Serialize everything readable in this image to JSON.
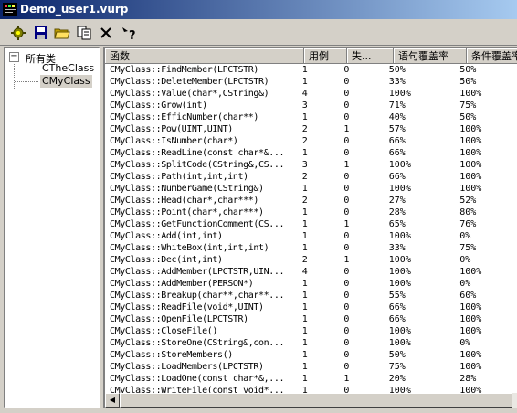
{
  "window": {
    "title": "Demo_user1.vurp"
  },
  "toolbar": {
    "buttons": [
      {
        "name": "settings-button",
        "icon": "gear-icon"
      },
      {
        "name": "save-button",
        "icon": "floppy-icon"
      },
      {
        "name": "open-button",
        "icon": "folder-open-icon"
      },
      {
        "name": "copy-button",
        "icon": "copy-icon"
      },
      {
        "name": "delete-button",
        "icon": "close-icon"
      },
      {
        "name": "help-button",
        "icon": "help-icon"
      }
    ]
  },
  "tree": {
    "root": {
      "label": "所有类",
      "expander": "−"
    },
    "children": [
      "CTheClass",
      "CMyClass"
    ]
  },
  "table": {
    "columns": [
      "函数",
      "用例",
      "失...",
      "语句覆盖率",
      "条件覆盖率"
    ],
    "rows": [
      [
        "CMyClass::FindMember(LPCTSTR)",
        "1",
        "0",
        "50%",
        "50%"
      ],
      [
        "CMyClass::DeleteMember(LPCTSTR)",
        "1",
        "0",
        "33%",
        "50%"
      ],
      [
        "CMyClass::Value(char*,CString&)",
        "4",
        "0",
        "100%",
        "100%"
      ],
      [
        "CMyClass::Grow(int)",
        "3",
        "0",
        "71%",
        "75%"
      ],
      [
        "CMyClass::EfficNumber(char**)",
        "1",
        "0",
        "40%",
        "50%"
      ],
      [
        "CMyClass::Pow(UINT,UINT)",
        "2",
        "1",
        "57%",
        "100%"
      ],
      [
        "CMyClass::IsNumber(char*)",
        "2",
        "0",
        "66%",
        "100%"
      ],
      [
        "CMyClass::ReadLine(const char*&...",
        "1",
        "0",
        "66%",
        "100%"
      ],
      [
        "CMyClass::SplitCode(CString&,CS...",
        "3",
        "1",
        "100%",
        "100%"
      ],
      [
        "CMyClass::Path(int,int,int)",
        "2",
        "0",
        "66%",
        "100%"
      ],
      [
        "CMyClass::NumberGame(CString&)",
        "1",
        "0",
        "100%",
        "100%"
      ],
      [
        "CMyClass::Head(char*,char***)",
        "2",
        "0",
        "27%",
        "52%"
      ],
      [
        "CMyClass::Point(char*,char***)",
        "1",
        "0",
        "28%",
        "80%"
      ],
      [
        "CMyClass::GetFunctionComment(CS...",
        "1",
        "1",
        "65%",
        "76%"
      ],
      [
        "CMyClass::Add(int,int)",
        "1",
        "0",
        "100%",
        "0%"
      ],
      [
        "CMyClass::WhiteBox(int,int,int)",
        "1",
        "0",
        "33%",
        "75%"
      ],
      [
        "CMyClass::Dec(int,int)",
        "2",
        "1",
        "100%",
        "0%"
      ],
      [
        "CMyClass::AddMember(LPCTSTR,UIN...",
        "4",
        "0",
        "100%",
        "100%"
      ],
      [
        "CMyClass::AddMember(PERSON*)",
        "1",
        "0",
        "100%",
        "0%"
      ],
      [
        "CMyClass::Breakup(char**,char**...",
        "1",
        "0",
        "55%",
        "60%"
      ],
      [
        "CMyClass::ReadFile(void*,UINT)",
        "1",
        "0",
        "66%",
        "100%"
      ],
      [
        "CMyClass::OpenFile(LPCTSTR)",
        "1",
        "0",
        "66%",
        "100%"
      ],
      [
        "CMyClass::CloseFile()",
        "1",
        "0",
        "100%",
        "100%"
      ],
      [
        "CMyClass::StoreOne(CString&,con...",
        "1",
        "0",
        "100%",
        "0%"
      ],
      [
        "CMyClass::StoreMembers()",
        "1",
        "0",
        "50%",
        "100%"
      ],
      [
        "CMyClass::LoadMembers(LPCTSTR)",
        "1",
        "0",
        "75%",
        "100%"
      ],
      [
        "CMyClass::LoadOne(const char*&,...",
        "1",
        "1",
        "20%",
        "28%"
      ],
      [
        "CMyClass::WriteFile(const void*...",
        "1",
        "0",
        "100%",
        "100%"
      ]
    ]
  }
}
